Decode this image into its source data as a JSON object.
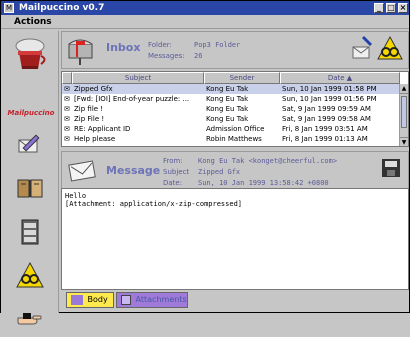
{
  "window": {
    "title": "Mailpuccino v0.7"
  },
  "menu": {
    "items": [
      "Actions"
    ]
  },
  "sidebar": {
    "logo_text": "Mailpuccino"
  },
  "inbox": {
    "title": "Inbox",
    "folder_label": "Folder:",
    "folder_value": "Pop3 Folder",
    "messages_label": "Messages:",
    "messages_value": "26"
  },
  "table": {
    "headers": [
      "Subject",
      "Sender",
      "Date"
    ],
    "rows": [
      {
        "subject": "Zipped Gfx",
        "sender": "Kong Eu Tak",
        "date": "Sun, 10 Jan 1999 01:58 PM",
        "selected": true
      },
      {
        "subject": "[Fwd: [IOI] End-of-year puzzle: ...",
        "sender": "Kong Eu Tak",
        "date": "Sun, 10 Jan 1999 01:56 PM",
        "selected": false
      },
      {
        "subject": "Zip file !",
        "sender": "Kong Eu Tak",
        "date": "Sat, 9 Jan 1999 09:59 AM",
        "selected": false
      },
      {
        "subject": "Zip File !",
        "sender": "Kong Eu Tak",
        "date": "Sat, 9 Jan 1999 09:58 AM",
        "selected": false
      },
      {
        "subject": "RE: Applicant ID",
        "sender": "Admission Office",
        "date": "Fri, 8 Jan 1999 03:51 AM",
        "selected": false
      },
      {
        "subject": "Help please",
        "sender": "Robin Matthews",
        "date": "Fri, 8 Jan 1999 01:13 AM",
        "selected": false
      }
    ]
  },
  "message": {
    "title": "Message",
    "from_label": "From:",
    "from_value": "Kong Eu Tak <konget@cheerful.com>",
    "subject_label": "Subject",
    "subject_value": "Zipped Gfx",
    "date_label": "Date:",
    "date_value": "Sun, 10 Jan 1999 13:58:42 +0800",
    "body_lines": [
      "Hello",
      "[Attachment: application/x-zip-compressed]"
    ]
  },
  "tabs": [
    {
      "label": "Body",
      "selected": true
    },
    {
      "label": "Attachments",
      "selected": false
    }
  ],
  "colors": {
    "accent": "#6d73b7",
    "selection": "#c9d0ea",
    "brand_red": "#c6232b"
  }
}
